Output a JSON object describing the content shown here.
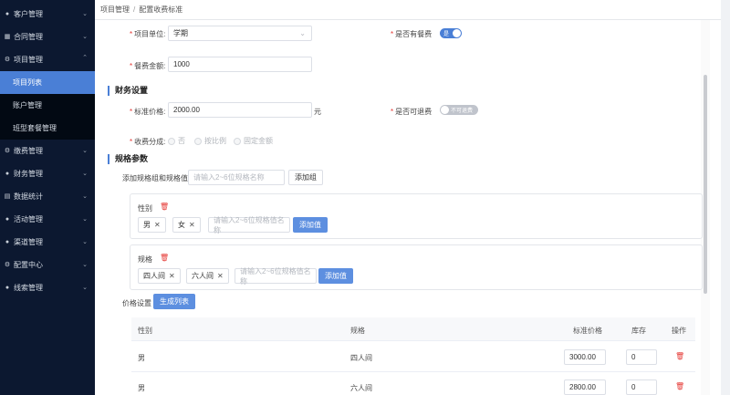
{
  "sidebar": {
    "items": [
      {
        "label": "客户管理",
        "icon": "user-icon"
      },
      {
        "label": "合同管理",
        "icon": "contract-icon"
      },
      {
        "label": "项目管理",
        "icon": "gear-icon"
      },
      {
        "label": "缴费管理",
        "icon": "gear-icon"
      },
      {
        "label": "财务管理",
        "icon": "user-icon"
      },
      {
        "label": "数据统计",
        "icon": "document-icon"
      },
      {
        "label": "活动管理",
        "icon": "user-icon"
      },
      {
        "label": "渠道管理",
        "icon": "user-icon"
      },
      {
        "label": "配置中心",
        "icon": "gear-icon"
      },
      {
        "label": "线索管理",
        "icon": "user-icon"
      }
    ],
    "sub_items": [
      {
        "label": "项目列表"
      },
      {
        "label": "账户管理"
      },
      {
        "label": "班型套餐管理"
      }
    ]
  },
  "breadcrumb": {
    "items": [
      "项目管理",
      "配置收费标准"
    ],
    "separator": "/"
  },
  "form": {
    "unit_label": "项目单位:",
    "unit_value": "学期",
    "meal_label": "是否有餐费",
    "meal_toggle_text": "是",
    "meal_amount_label": "餐费金额:",
    "meal_amount_value": "1000",
    "finance_title": "财务设置",
    "std_price_label": "标准价格:",
    "std_price_value": "2000.00",
    "std_price_unit": "元",
    "refund_label": "是否可退费",
    "refund_toggle_text": "不可退费",
    "split_label": "收费分成:",
    "split_options": [
      "否",
      "按比例",
      "固定金额"
    ],
    "spec_title": "规格参数",
    "add_spec_label": "添加规格组和规格值",
    "add_spec_placeholder": "请输入2~6位规格名称",
    "add_group_button": "添加组",
    "groups": [
      {
        "name": "性别",
        "tags": [
          "男",
          "女"
        ],
        "placeholder": "请输入2~6位规格值名称",
        "add_button": "添加值"
      },
      {
        "name": "规格",
        "tags": [
          "四人间",
          "六人间"
        ],
        "placeholder": "请输入2~6位规格值名称",
        "add_button": "添加值"
      }
    ],
    "price_setting_label": "价格设置",
    "generate_button": "生成列表"
  },
  "table": {
    "headers": [
      "性别",
      "规格",
      "标准价格",
      "库存",
      "操作"
    ],
    "rows": [
      {
        "gender": "男",
        "spec": "四人间",
        "price": "3000.00",
        "stock": "0"
      },
      {
        "gender": "男",
        "spec": "六人间",
        "price": "2800.00",
        "stock": "0"
      }
    ]
  },
  "colors": {
    "accent": "#4a7fd6",
    "sidebar_bg": "#0c1830",
    "danger": "#e53935"
  }
}
